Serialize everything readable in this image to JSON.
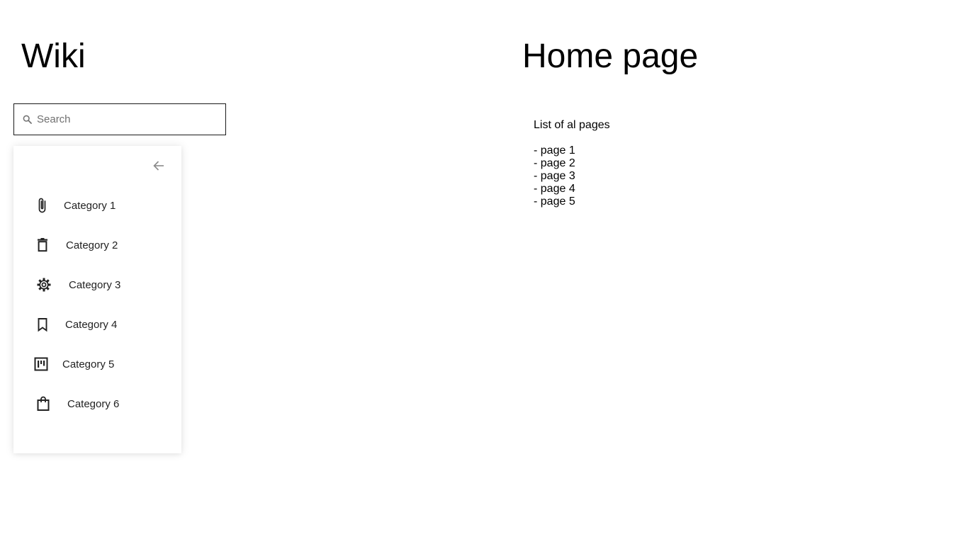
{
  "sidebar": {
    "title": "Wiki",
    "search": {
      "placeholder": "Search",
      "value": ""
    },
    "back_icon": "arrow-left-icon",
    "categories": [
      {
        "label": "Category 1",
        "icon": "paperclip-icon"
      },
      {
        "label": "Category 2",
        "icon": "trash-icon"
      },
      {
        "label": "Category 3",
        "icon": "gear-icon"
      },
      {
        "label": "Category 4",
        "icon": "bookmark-icon"
      },
      {
        "label": "Category 5",
        "icon": "kanban-board-icon"
      },
      {
        "label": "Category 6",
        "icon": "shopping-bag-icon"
      }
    ]
  },
  "main": {
    "title": "Home page",
    "intro": "List of al pages",
    "pages": [
      "- page 1",
      "- page 2",
      "- page 3",
      "- page 4",
      "- page 5"
    ]
  }
}
